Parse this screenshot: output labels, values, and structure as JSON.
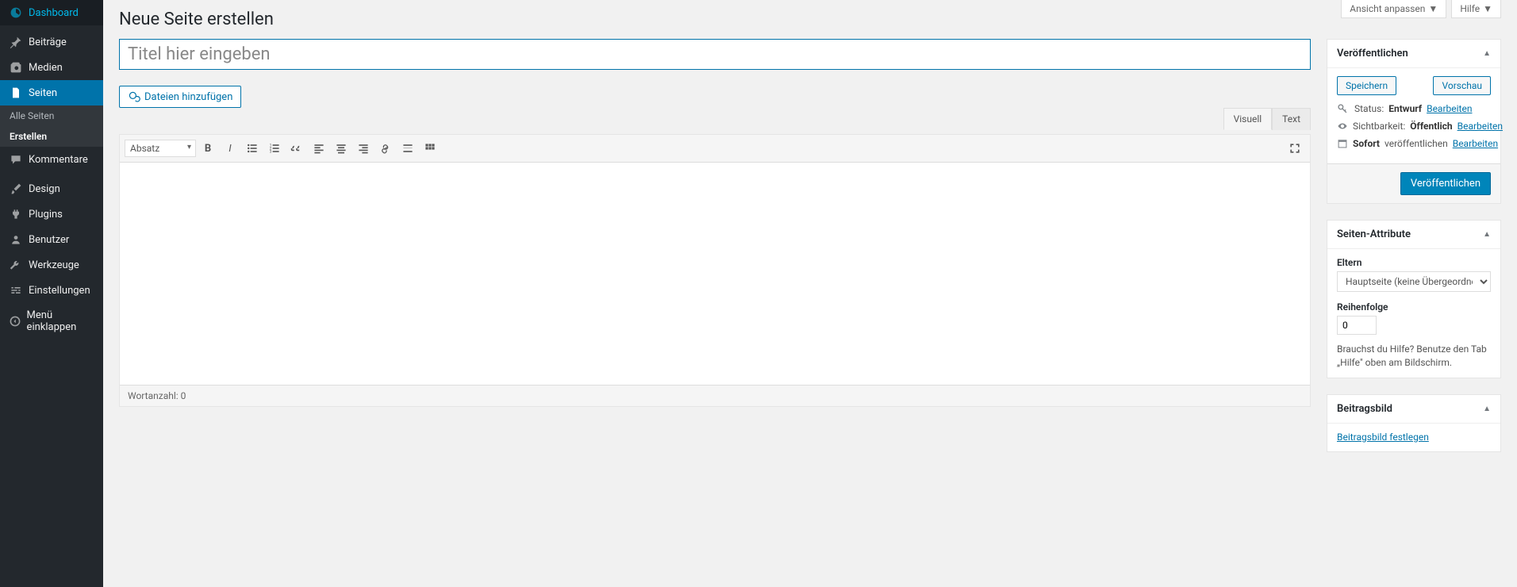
{
  "topTabs": {
    "screenOptions": "Ansicht anpassen",
    "help": "Hilfe"
  },
  "sidebar": {
    "items": [
      {
        "label": "Dashboard"
      },
      {
        "label": "Beiträge"
      },
      {
        "label": "Medien"
      },
      {
        "label": "Seiten"
      },
      {
        "label": "Kommentare"
      },
      {
        "label": "Design"
      },
      {
        "label": "Plugins"
      },
      {
        "label": "Benutzer"
      },
      {
        "label": "Werkzeuge"
      },
      {
        "label": "Einstellungen"
      },
      {
        "label": "Menü einklappen"
      }
    ],
    "sub": {
      "all": "Alle Seiten",
      "new": "Erstellen"
    }
  },
  "page": {
    "heading": "Neue Seite erstellen",
    "titlePlaceholder": "Titel hier eingeben",
    "addMedia": "Dateien hinzufügen",
    "tabVisual": "Visuell",
    "tabText": "Text",
    "format": "Absatz",
    "wordCount": "Wortanzahl: 0"
  },
  "publish": {
    "boxTitle": "Veröffentlichen",
    "save": "Speichern",
    "preview": "Vorschau",
    "statusLabel": "Status:",
    "statusValue": "Entwurf",
    "visibilityLabel": "Sichtbarkeit:",
    "visibilityValue": "Öffentlich",
    "scheduleLabel1": "Sofort",
    "scheduleLabel2": "veröffentlichen",
    "edit": "Bearbeiten",
    "publishBtn": "Veröffentlichen"
  },
  "attrs": {
    "boxTitle": "Seiten-Attribute",
    "parentLabel": "Eltern",
    "parentValue": "Hauptseite (keine Übergeordnete)",
    "orderLabel": "Reihenfolge",
    "orderValue": "0",
    "helpText": "Brauchst du Hilfe? Benutze den Tab „Hilfe\" oben am Bildschirm."
  },
  "featured": {
    "boxTitle": "Beitragsbild",
    "setLink": "Beitragsbild festlegen"
  }
}
